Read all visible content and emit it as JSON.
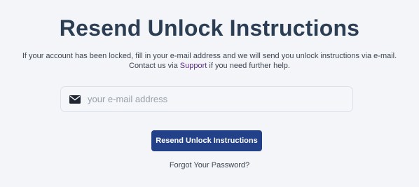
{
  "page": {
    "title": "Resend Unlock Instructions",
    "description_line1": "If your account has been locked, fill in your e-mail address and we will send you unlock instructions via e-mail.",
    "description_line2_before": "Contact us via ",
    "support_link": "Support",
    "description_line2_after": " if you need further help."
  },
  "form": {
    "email_icon": "envelope-icon",
    "email_value": "",
    "email_placeholder": "your e-mail address",
    "submit_label": "Resend Unlock Instructions"
  },
  "links": {
    "forgot_password": "Forgot Your Password?"
  },
  "colors": {
    "background": "#f3f5f9",
    "title": "#2b3e54",
    "button": "#234189",
    "support_link": "#5d2a8a"
  }
}
